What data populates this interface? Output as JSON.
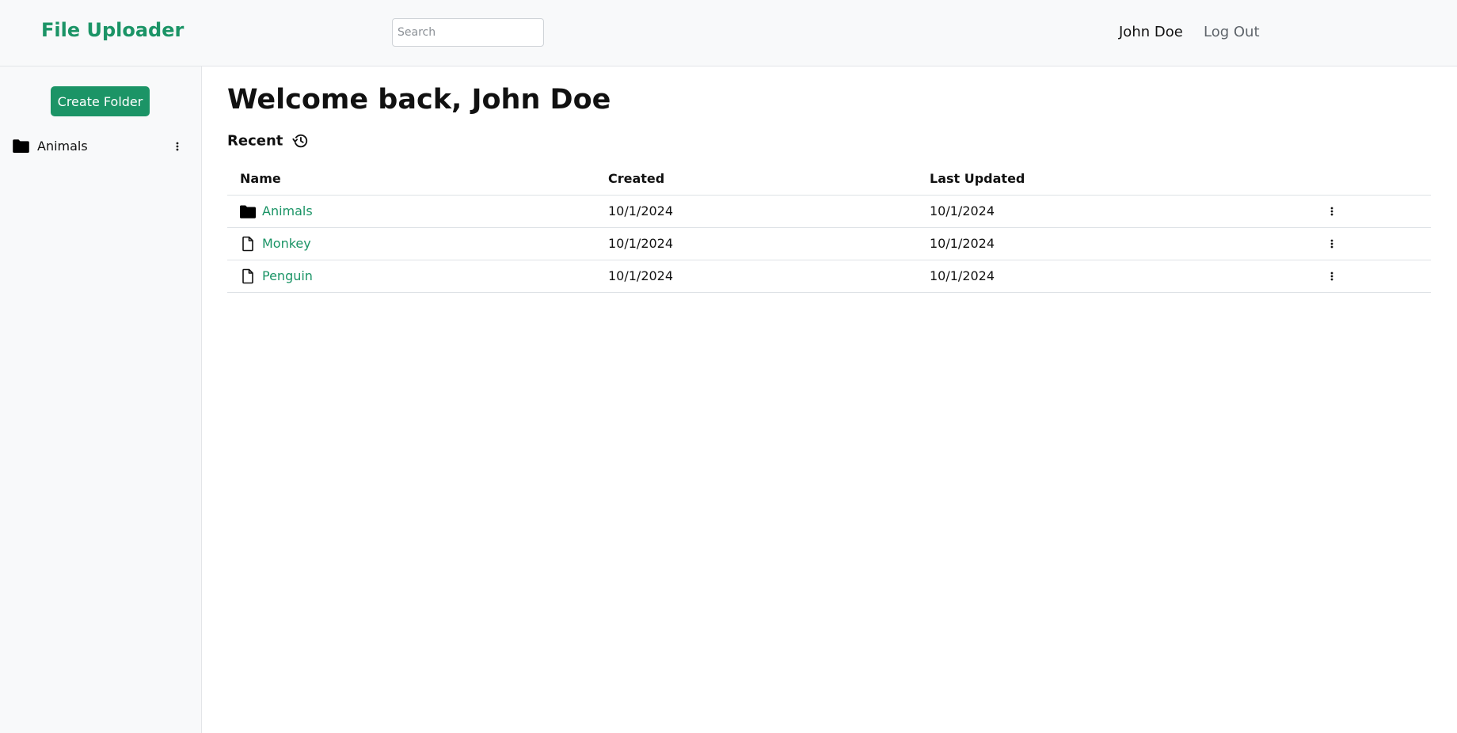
{
  "header": {
    "brand": "File Uploader",
    "search_placeholder": "Search",
    "user_name": "John Doe",
    "logout_label": "Log Out",
    "brand_color": "#1b9466"
  },
  "sidebar": {
    "create_folder_label": "Create Folder",
    "items": [
      {
        "label": "Animals",
        "icon": "folder-icon"
      }
    ]
  },
  "main": {
    "title": "Welcome back, John Doe",
    "section_label": "Recent",
    "section_icon": "history-icon",
    "table": {
      "columns": [
        "Name",
        "Created",
        "Last Updated"
      ],
      "rows": [
        {
          "icon": "folder-icon",
          "name": "Animals",
          "created": "10/1/2024",
          "updated": "10/1/2024"
        },
        {
          "icon": "file-icon",
          "name": "Monkey",
          "created": "10/1/2024",
          "updated": "10/1/2024"
        },
        {
          "icon": "file-icon",
          "name": "Penguin",
          "created": "10/1/2024",
          "updated": "10/1/2024"
        }
      ]
    }
  }
}
